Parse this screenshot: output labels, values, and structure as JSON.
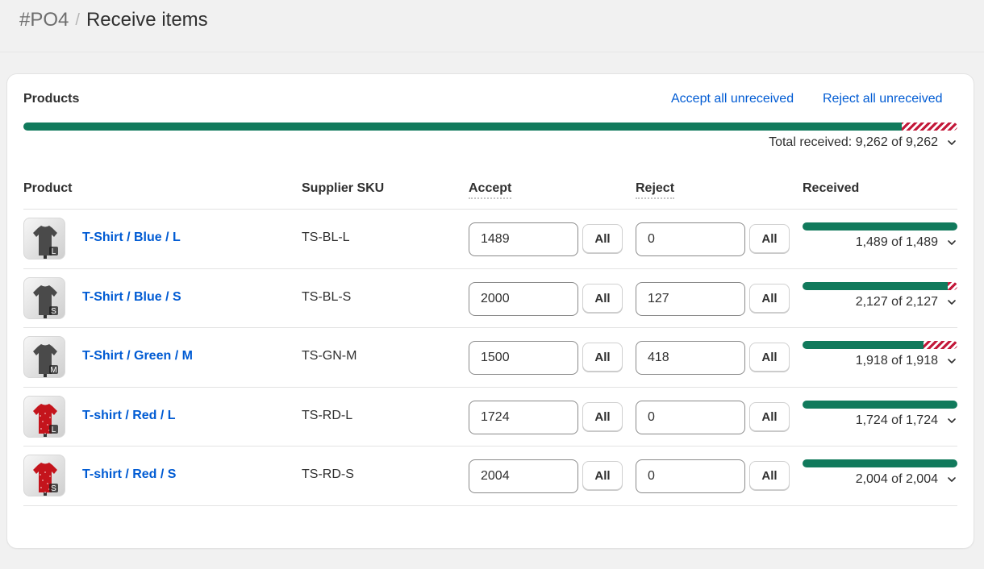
{
  "breadcrumb": {
    "po": "#PO4",
    "separator": "/",
    "title": "Receive items"
  },
  "card": {
    "title": "Products",
    "accept_all": "Accept all unreceived",
    "reject_all": "Reject all unreceived",
    "total_received": "Total received: 9,262 of 9,262",
    "total_bar": {
      "accepted_fraction": 0.94,
      "rejected_fraction": 0.06
    }
  },
  "columns": {
    "product": "Product",
    "sku": "Supplier SKU",
    "accept": "Accept",
    "reject": "Reject",
    "received": "Received"
  },
  "all_label": "All",
  "colors": {
    "accent": "#005bd3",
    "accepted": "#117a5c",
    "rejected": "#c3193a"
  },
  "rows": [
    {
      "thumb_label": "L",
      "thumb_color": "grey",
      "name": "T-Shirt / Blue / L",
      "sku": "TS-BL-L",
      "accept": "1489",
      "reject": "0",
      "received": "1,489 of 1,489",
      "accepted_fraction": 1.0,
      "rejected_fraction": 0.0
    },
    {
      "thumb_label": "S",
      "thumb_color": "grey",
      "name": "T-Shirt / Blue / S",
      "sku": "TS-BL-S",
      "accept": "2000",
      "reject": "127",
      "received": "2,127 of 2,127",
      "accepted_fraction": 0.94,
      "rejected_fraction": 0.06
    },
    {
      "thumb_label": "M",
      "thumb_color": "grey",
      "name": "T-Shirt / Green / M",
      "sku": "TS-GN-M",
      "accept": "1500",
      "reject": "418",
      "received": "1,918 of 1,918",
      "accepted_fraction": 0.78,
      "rejected_fraction": 0.22
    },
    {
      "thumb_label": "L",
      "thumb_color": "red",
      "name": "T-shirt / Red / L",
      "sku": "TS-RD-L",
      "accept": "1724",
      "reject": "0",
      "received": "1,724 of 1,724",
      "accepted_fraction": 1.0,
      "rejected_fraction": 0.0
    },
    {
      "thumb_label": "S",
      "thumb_color": "red",
      "name": "T-shirt / Red / S",
      "sku": "TS-RD-S",
      "accept": "2004",
      "reject": "0",
      "received": "2,004 of 2,004",
      "accepted_fraction": 1.0,
      "rejected_fraction": 0.0
    }
  ]
}
